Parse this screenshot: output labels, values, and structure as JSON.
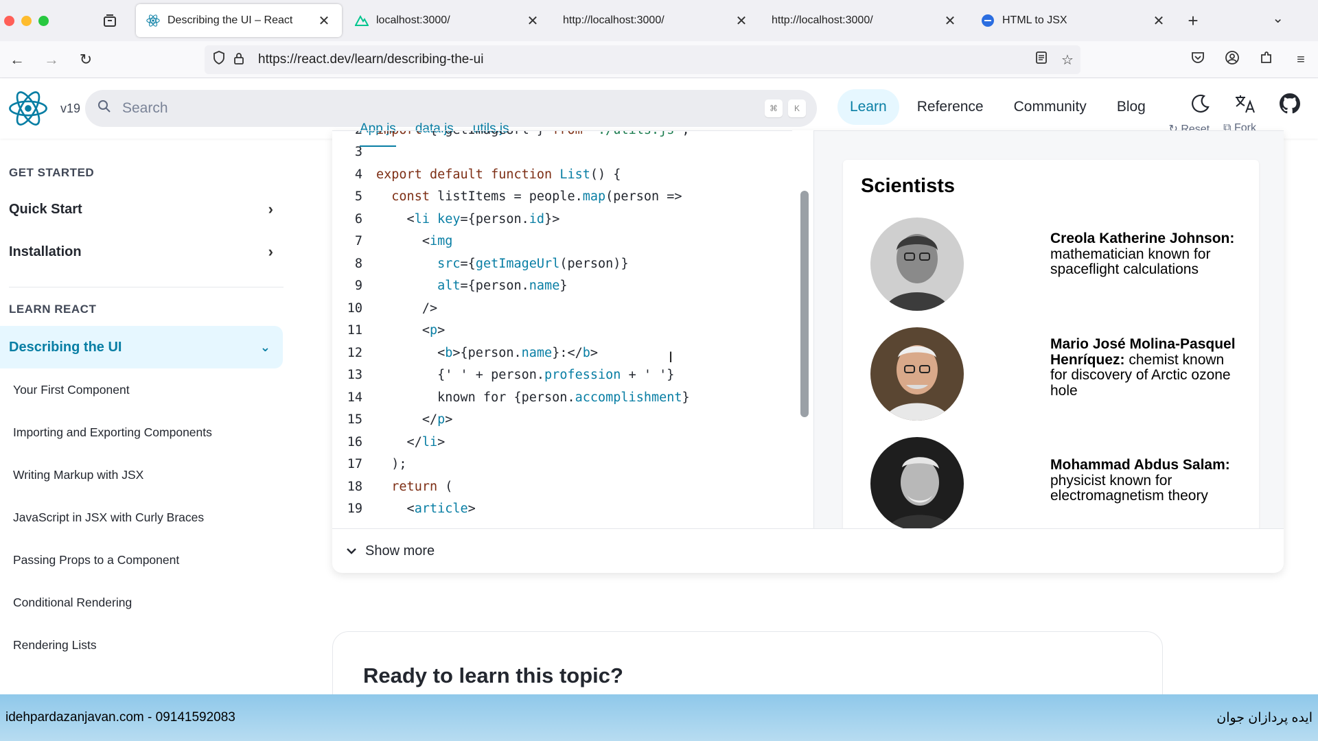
{
  "browser": {
    "tabs": [
      {
        "title": "Describing the UI – React",
        "icon": "react-icon",
        "active": true
      },
      {
        "title": "localhost:3000/",
        "icon": "nuxt-icon",
        "active": false
      },
      {
        "title": "http://localhost:3000/",
        "icon": "",
        "active": false
      },
      {
        "title": "http://localhost:3000/",
        "icon": "",
        "active": false
      },
      {
        "title": "HTML to JSX",
        "icon": "transform-icon",
        "active": false
      }
    ],
    "url": "https://react.dev/learn/describing-the-ui"
  },
  "header": {
    "version": "v19",
    "search_placeholder": "Search",
    "kbd_cmd": "⌘",
    "kbd_k": "K",
    "nav": [
      {
        "label": "Learn",
        "active": true
      },
      {
        "label": "Reference",
        "active": false
      },
      {
        "label": "Community",
        "active": false
      },
      {
        "label": "Blog",
        "active": false
      }
    ]
  },
  "sidebar": {
    "section_get_started": "GET STARTED",
    "quick_start": "Quick Start",
    "installation": "Installation",
    "section_learn_react": "LEARN REACT",
    "active_item": "Describing the UI",
    "items": [
      "Your First Component",
      "Importing and Exporting Components",
      "Writing Markup with JSX",
      "JavaScript in JSX with Curly Braces",
      "Passing Props to a Component",
      "Conditional Rendering",
      "Rendering Lists"
    ]
  },
  "sandpack": {
    "file_tabs": [
      "App.js",
      "data.js",
      "utils.js"
    ],
    "actions": [
      "Reset",
      "Fork"
    ],
    "code_lines": [
      {
        "n": "2",
        "parts": [
          [
            "kw",
            "import"
          ],
          [
            "tx",
            " { getImageUrl } "
          ],
          [
            "kw",
            "from"
          ],
          [
            "st",
            " './utils.js'"
          ],
          [
            "tx",
            ";"
          ]
        ]
      },
      {
        "n": "3",
        "parts": []
      },
      {
        "n": "4",
        "parts": [
          [
            "kw",
            "export default function "
          ],
          [
            "fn",
            "List"
          ],
          [
            "tx",
            "() {"
          ]
        ]
      },
      {
        "n": "5",
        "parts": [
          [
            "tx",
            "  "
          ],
          [
            "kw",
            "const "
          ],
          [
            "tx",
            "listItems = people."
          ],
          [
            "fn",
            "map"
          ],
          [
            "tx",
            "(person =>"
          ]
        ]
      },
      {
        "n": "6",
        "parts": [
          [
            "tx",
            "    <"
          ],
          [
            "tag",
            "li "
          ],
          [
            "fn",
            "key"
          ],
          [
            "tx",
            "={person."
          ],
          [
            "fn",
            "id"
          ],
          [
            "tx",
            "}>"
          ]
        ]
      },
      {
        "n": "7",
        "parts": [
          [
            "tx",
            "      <"
          ],
          [
            "tag",
            "img"
          ]
        ]
      },
      {
        "n": "8",
        "parts": [
          [
            "tx",
            "        "
          ],
          [
            "fn",
            "src"
          ],
          [
            "tx",
            "={"
          ],
          [
            "fn",
            "getImageUrl"
          ],
          [
            "tx",
            "(person)}"
          ]
        ]
      },
      {
        "n": "9",
        "parts": [
          [
            "tx",
            "        "
          ],
          [
            "fn",
            "alt"
          ],
          [
            "tx",
            "={person."
          ],
          [
            "fn",
            "name"
          ],
          [
            "tx",
            "}"
          ]
        ]
      },
      {
        "n": "10",
        "parts": [
          [
            "tx",
            "      />"
          ]
        ]
      },
      {
        "n": "11",
        "parts": [
          [
            "tx",
            "      <"
          ],
          [
            "tag",
            "p"
          ],
          [
            "tx",
            ">"
          ]
        ]
      },
      {
        "n": "12",
        "parts": [
          [
            "tx",
            "        <"
          ],
          [
            "tag",
            "b"
          ],
          [
            "tx",
            ">{person."
          ],
          [
            "fn",
            "name"
          ],
          [
            "tx",
            "}:</"
          ],
          [
            "tag",
            "b"
          ],
          [
            "tx",
            ">"
          ]
        ]
      },
      {
        "n": "13",
        "parts": [
          [
            "tx",
            "        {' ' + person."
          ],
          [
            "fn",
            "profession"
          ],
          [
            "tx",
            " + ' '}"
          ]
        ]
      },
      {
        "n": "14",
        "parts": [
          [
            "tx",
            "        known for {person."
          ],
          [
            "fn",
            "accomplishment"
          ],
          [
            "tx",
            "}"
          ]
        ]
      },
      {
        "n": "15",
        "parts": [
          [
            "tx",
            "      </"
          ],
          [
            "tag",
            "p"
          ],
          [
            "tx",
            ">"
          ]
        ]
      },
      {
        "n": "16",
        "parts": [
          [
            "tx",
            "    </"
          ],
          [
            "tag",
            "li"
          ],
          [
            "tx",
            ">"
          ]
        ]
      },
      {
        "n": "17",
        "parts": [
          [
            "tx",
            "  );"
          ]
        ]
      },
      {
        "n": "18",
        "parts": [
          [
            "tx",
            "  "
          ],
          [
            "kw",
            "return"
          ],
          [
            "tx",
            " ("
          ]
        ]
      },
      {
        "n": "19",
        "parts": [
          [
            "tx",
            "    <"
          ],
          [
            "tag",
            "article"
          ],
          [
            "tx",
            ">"
          ]
        ]
      }
    ],
    "preview": {
      "title": "Scientists",
      "people": [
        {
          "name": "Creola Katherine Johnson:",
          "desc": " mathematician known for spaceflight calculations"
        },
        {
          "name": "Mario José Molina-Pasquel Henríquez:",
          "desc": " chemist known for discovery of Arctic ozone hole"
        },
        {
          "name": "Mohammad Abdus Salam:",
          "desc": " physicist known for electromagnetism theory"
        }
      ]
    },
    "show_more": "Show more"
  },
  "ready": {
    "title": "Ready to learn this topic?"
  },
  "banner": {
    "left": "idehpardazanjavan.com - 09141592083",
    "right": "ایده پردازان جوان"
  }
}
